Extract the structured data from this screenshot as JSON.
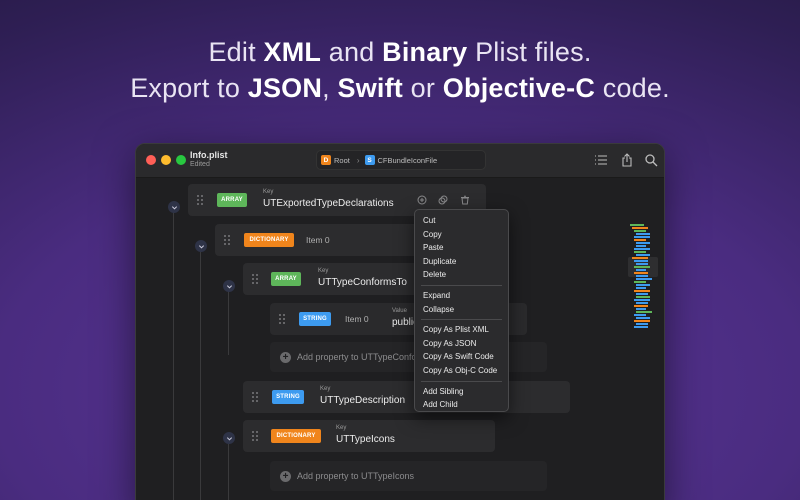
{
  "headline": {
    "line1": [
      {
        "t": "Edit ",
        "b": false
      },
      {
        "t": "XML",
        "b": true
      },
      {
        "t": " and ",
        "b": false
      },
      {
        "t": "Binary",
        "b": true
      },
      {
        "t": " Plist files.",
        "b": false
      }
    ],
    "line2": [
      {
        "t": "Export to ",
        "b": false
      },
      {
        "t": "JSON",
        "b": true
      },
      {
        "t": ", ",
        "b": false
      },
      {
        "t": "Swift",
        "b": true
      },
      {
        "t": " or ",
        "b": false
      },
      {
        "t": "Objective-C",
        "b": true
      },
      {
        "t": " code.",
        "b": false
      }
    ]
  },
  "window": {
    "title": "Info.plist",
    "subtitle": "Edited",
    "breadcrumb": {
      "root_badge": "D",
      "root_label": "Root",
      "child_badge": "S",
      "child_label": "CFBundleIconFile"
    },
    "toolbar_icons": [
      "list-icon",
      "share-icon",
      "search-icon"
    ]
  },
  "tree": {
    "key_label": "Key",
    "value_label": "Value",
    "row1": {
      "type": "ARRAY",
      "key": "UTExportedTypeDeclarations"
    },
    "row2": {
      "type": "DICTIONARY",
      "item": "Item 0"
    },
    "row3": {
      "type": "ARRAY",
      "key": "UTTypeConformsTo"
    },
    "row4": {
      "type": "STRING",
      "item": "Item 0",
      "value": "public.data"
    },
    "add1": "Add property to UTTypeConformsTo",
    "row5": {
      "type": "STRING",
      "key": "UTTypeDescription"
    },
    "row6": {
      "type": "DICTIONARY",
      "key": "UTTypeIcons"
    },
    "add2": "Add property to UTTypeIcons"
  },
  "context_menu": {
    "group1": [
      "Cut",
      "Copy",
      "Paste",
      "Duplicate",
      "Delete"
    ],
    "group2": [
      "Expand",
      "Collapse"
    ],
    "group3": [
      "Copy As Plist XML",
      "Copy As JSON",
      "Copy As Swift Code",
      "Copy As Obj-C Code"
    ],
    "group4": [
      "Add Sibling",
      "Add Child"
    ]
  },
  "colors": {
    "array": "#5eb65a",
    "dictionary": "#f0851c",
    "string": "#3d9bf0"
  }
}
